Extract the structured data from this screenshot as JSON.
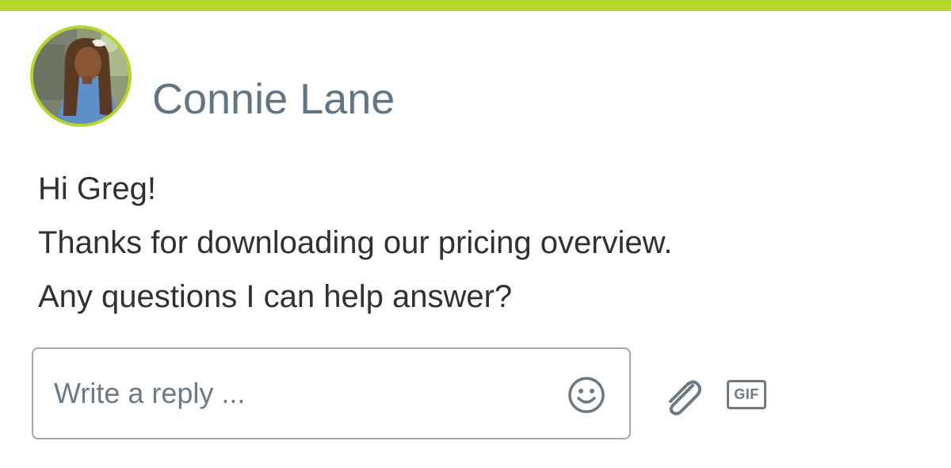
{
  "colors": {
    "accent": "#b5d62a",
    "name_text": "#627585",
    "message_text": "#2f3133",
    "icon": "#6b7a85",
    "input_border": "#9eaab3"
  },
  "sender": {
    "name": "Connie Lane"
  },
  "message": {
    "lines": [
      "Hi Greg!",
      "Thanks for downloading our pricing overview.",
      "Any questions I can help answer?"
    ]
  },
  "reply": {
    "placeholder": "Write a reply ...",
    "value": ""
  },
  "icons": {
    "emoji": "smiley-face-icon",
    "attach": "paperclip-icon",
    "gif": "gif-icon"
  },
  "gif_label": "GIF"
}
